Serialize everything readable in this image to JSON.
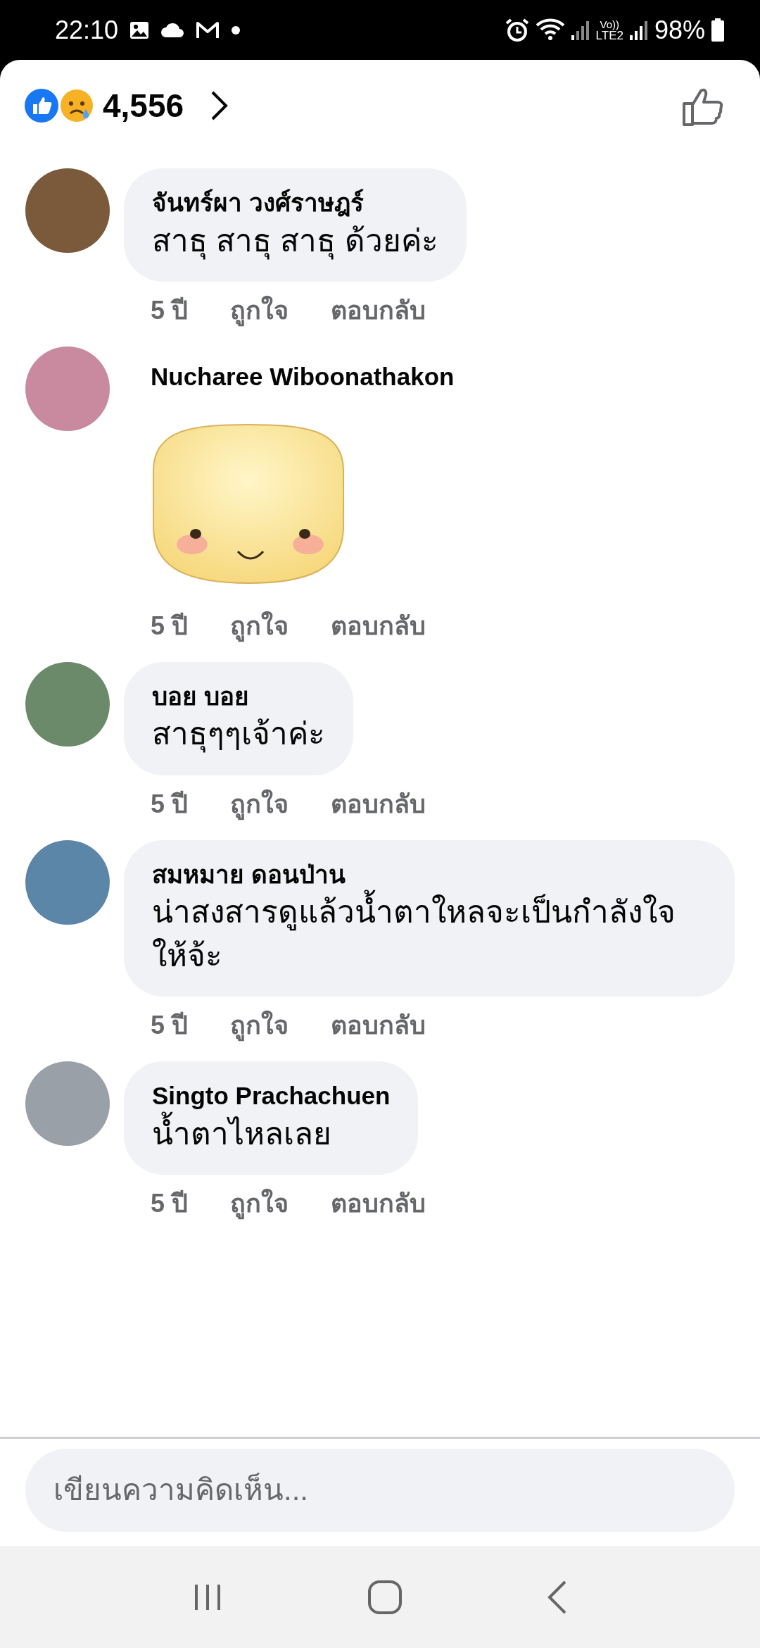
{
  "status_bar": {
    "time": "22:10",
    "volte": "Vo))",
    "lte": "LTE2",
    "battery": "98%"
  },
  "reactions": {
    "count": "4,556"
  },
  "comments": [
    {
      "kind": "text",
      "name": "จันทร์ผา วงศ์ราษฎร์",
      "text": "สาธุ สาธุ สาธุ ด้วยค่ะ",
      "age": "5 ปี",
      "like": "ถูกใจ",
      "reply": "ตอบกลับ"
    },
    {
      "kind": "sticker",
      "name": "Nucharee Wiboonathakon",
      "age": "5 ปี",
      "like": "ถูกใจ",
      "reply": "ตอบกลับ"
    },
    {
      "kind": "text",
      "name": "บอย บอย",
      "text": "สาธุๆๆเจ้าค่ะ",
      "age": "5 ปี",
      "like": "ถูกใจ",
      "reply": "ตอบกลับ"
    },
    {
      "kind": "text",
      "name": "สมหมาย ดอนป่าน",
      "text": "น่าสงสารดูแล้วน้ำตาใหลจะเป็นกำลังใจให้จ้ะ",
      "age": "5 ปี",
      "like": "ถูกใจ",
      "reply": "ตอบกลับ"
    },
    {
      "kind": "text",
      "name": "Singto Prachachuen",
      "text": "น้ำตาไหลเลย",
      "age": "5 ปี",
      "like": "ถูกใจ",
      "reply": "ตอบกลับ"
    }
  ],
  "composer": {
    "placeholder": "เขียนความคิดเห็น..."
  }
}
